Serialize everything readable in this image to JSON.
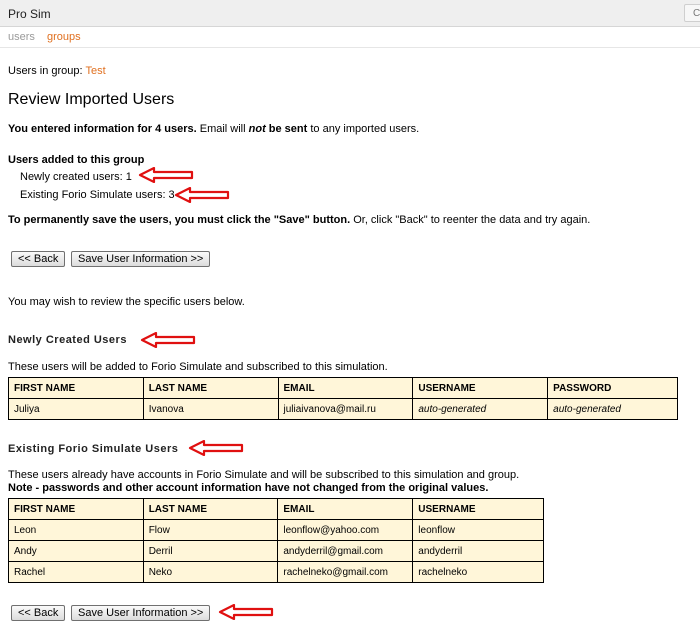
{
  "app": {
    "title": "Pro Sim",
    "corner_label": "C"
  },
  "nav": {
    "users": "users",
    "groups": "groups"
  },
  "group": {
    "prefix": "Users in group:",
    "name": "Test"
  },
  "page_title": "Review Imported Users",
  "summary": {
    "part1": "You entered information for 4 users.",
    "part2": " Email will ",
    "part3": "not",
    "part4": " be sent",
    "part5": " to any imported users."
  },
  "added": {
    "heading": "Users added to this group",
    "newly_created": "Newly created users: 1",
    "existing": "Existing Forio Simulate users: 3"
  },
  "save_notice": {
    "bold": "To permanently save the users, you must click the \"Save\" button.",
    "rest": " Or, click \"Back\" to reenter the data and try again."
  },
  "buttons": {
    "back": "<< Back",
    "save": "Save User Information >>"
  },
  "review_hint": "You may wish to review the specific users below.",
  "new_users": {
    "heading": "Newly Created Users",
    "description": "These users will be added to Forio Simulate and subscribed to this simulation.",
    "columns": [
      "FIRST NAME",
      "LAST NAME",
      "EMAIL",
      "USERNAME",
      "PASSWORD"
    ],
    "rows": [
      [
        "Juliya",
        "Ivanova",
        "juliaivanova@mail.ru",
        "auto-generated",
        "auto-generated"
      ]
    ]
  },
  "existing_users": {
    "heading": "Existing Forio Simulate Users",
    "description": "These users already have accounts in Forio Simulate and will be subscribed to this simulation and group.",
    "note": "Note - passwords and other account information have not changed from the original values.",
    "columns": [
      "FIRST NAME",
      "LAST NAME",
      "EMAIL",
      "USERNAME"
    ],
    "rows": [
      [
        "Leon",
        "Flow",
        "leonflow@yahoo.com",
        "leonflow"
      ],
      [
        "Andy",
        "Derril",
        "andyderril@gmail.com",
        "andyderril"
      ],
      [
        "Rachel",
        "Neko",
        "rachelneko@gmail.com",
        "rachelneko"
      ]
    ]
  },
  "colors": {
    "accent": "#e07020",
    "table_bg": "#fff6d9",
    "arrow": "#e01010"
  }
}
